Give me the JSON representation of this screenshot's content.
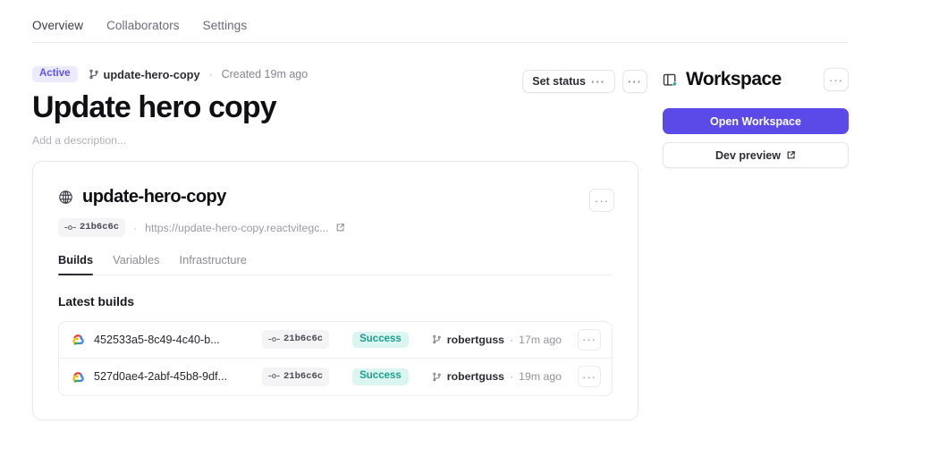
{
  "topnav": {
    "items": [
      {
        "label": "Overview",
        "active": true
      },
      {
        "label": "Collaborators",
        "active": false
      },
      {
        "label": "Settings",
        "active": false
      }
    ]
  },
  "header": {
    "status_badge": "Active",
    "branch_icon": "git-branch-icon",
    "branch": "update-hero-copy",
    "separator": "·",
    "created": "Created 19m ago",
    "title": "Update hero copy",
    "description_placeholder": "Add a description...",
    "set_status_label": "Set status",
    "set_status_dots": "···",
    "more_dots": "···"
  },
  "workspace": {
    "icon": "workspace-icon",
    "title": "Workspace",
    "more_dots": "···",
    "open_label": "Open Workspace",
    "dev_preview_label": "Dev preview",
    "accent_color": "#5b4ae8"
  },
  "service_card": {
    "icon": "globe-icon",
    "title": "update-hero-copy",
    "more_dots": "···",
    "commit_icon": "git-commit-icon",
    "commit_hash": "21b6c6c",
    "separator": "·",
    "url": "https://update-hero-copy.reactvitegc...",
    "external_link_icon": "external-link-icon",
    "tabs": [
      {
        "label": "Builds",
        "active": true
      },
      {
        "label": "Variables",
        "active": false
      },
      {
        "label": "Infrastructure",
        "active": false
      }
    ],
    "builds_heading": "Latest builds",
    "builds": [
      {
        "provider_icon": "google-cloud-icon",
        "id": "452533a5-8c49-4c40-b...",
        "commit_icon": "git-commit-icon",
        "commit_hash": "21b6c6c",
        "status": "Success",
        "author_icon": "git-branch-icon",
        "author": "robertguss",
        "separator": "·",
        "time": "17m ago",
        "more_dots": "···"
      },
      {
        "provider_icon": "google-cloud-icon",
        "id": "527d0ae4-2abf-45b8-9df...",
        "commit_icon": "git-commit-icon",
        "commit_hash": "21b6c6c",
        "status": "Success",
        "author_icon": "git-branch-icon",
        "author": "robertguss",
        "separator": "·",
        "time": "19m ago",
        "more_dots": "···"
      }
    ]
  },
  "colors": {
    "active_badge_bg": "#eceaff",
    "active_badge_text": "#6254e8",
    "success_badge_bg": "#dbf5f0",
    "success_badge_text": "#1d9e8d",
    "primary": "#5b4ae8"
  }
}
